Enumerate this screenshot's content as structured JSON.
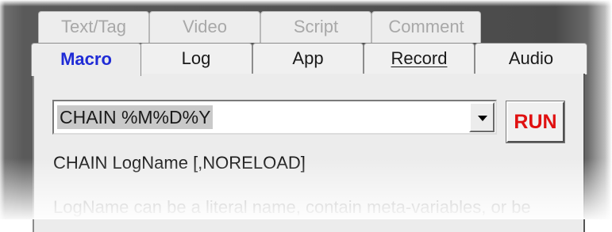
{
  "tabs": {
    "back_row": [
      "Text/Tag",
      "Video",
      "Script",
      "Comment"
    ],
    "front_row": [
      "Macro",
      "Log",
      "App",
      "Record",
      "Audio"
    ],
    "active": "Macro"
  },
  "macro": {
    "command_value": "CHAIN %M%D%Y",
    "run_label": "RUN",
    "syntax": "CHAIN LogName [,NORELOAD]",
    "description": "LogName can be a literal name, contain meta-variables, or be"
  },
  "colors": {
    "active_tab_text": "#1f2bd6",
    "run_text": "#e01010"
  }
}
